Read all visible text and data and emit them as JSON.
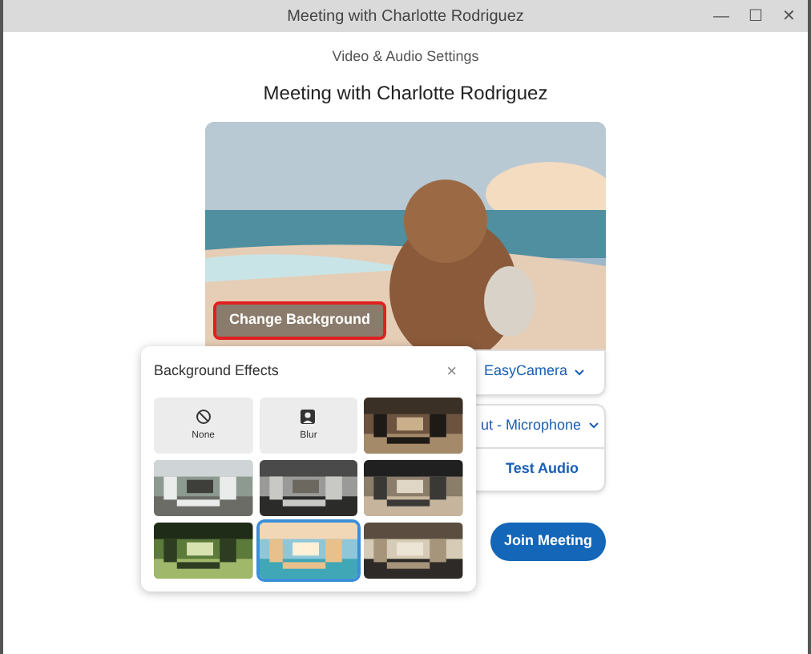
{
  "window": {
    "title": "Meeting with Charlotte Rodriguez",
    "controls": [
      "—",
      "☐",
      "✕"
    ]
  },
  "subtitle": "Video & Audio Settings",
  "heading": "Meeting with Charlotte Rodriguez",
  "preview": {
    "kind": "picture",
    "button": "Change Background",
    "button_highlighted": true
  },
  "camera": {
    "value": "EasyCamera"
  },
  "microphone": {
    "value": "ut - Microphone"
  },
  "test_audio": "Test Audio",
  "join_button": "Join Meeting",
  "background_effects": {
    "title": "Background Effects",
    "close": "×",
    "tiles": [
      {
        "kind": "none",
        "label": "None",
        "selected": false
      },
      {
        "kind": "blur",
        "label": "Blur",
        "selected": false
      },
      {
        "kind": "picture",
        "selected": false
      },
      {
        "kind": "picture",
        "selected": false
      },
      {
        "kind": "picture",
        "selected": false
      },
      {
        "kind": "picture",
        "selected": false
      },
      {
        "kind": "picture",
        "selected": false
      },
      {
        "kind": "picture",
        "selected": true
      },
      {
        "kind": "picture",
        "selected": false
      }
    ]
  }
}
